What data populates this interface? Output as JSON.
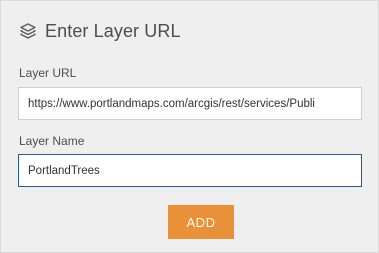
{
  "header": {
    "icon": "layers-icon",
    "title": "Enter Layer URL"
  },
  "form": {
    "url_label": "Layer URL",
    "url_value": "https://www.portlandmaps.com/arcgis/rest/services/Publi",
    "name_label": "Layer Name",
    "name_value": "PortlandTrees",
    "add_label": "ADD"
  },
  "colors": {
    "panel_background": "#efefef",
    "accent_button": "#e8903a",
    "focus_border": "#2e5a8c",
    "text": "#4d4d4d"
  }
}
